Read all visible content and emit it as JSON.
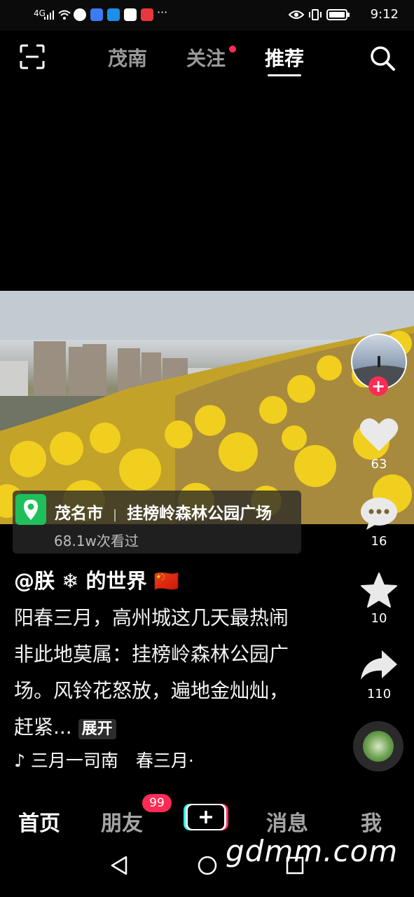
{
  "status_bar": {
    "signal": "4G",
    "time": "9:12"
  },
  "top_tabs": [
    {
      "label": "茂南"
    },
    {
      "label": "关注"
    },
    {
      "label": "推荐"
    }
  ],
  "video_stats": {
    "likes": "63",
    "comments": "16",
    "favorites": "10",
    "shares": "110"
  },
  "location": {
    "city": "茂名市",
    "place": "挂榜岭森林公园广场",
    "views": "68.1w次看过"
  },
  "post": {
    "author": "@朕 ❄ 的世界 🇨🇳",
    "caption": "阳春三月，高州城这几天最热闹非此地莫属：挂榜岭森林公园广场。风铃花怒放，遍地金灿灿，赶紧...",
    "expand_label": "展开"
  },
  "music": {
    "note": "♪",
    "title": "三月一司南　春三月·"
  },
  "bottom_nav": {
    "home": "首页",
    "friends": "朋友",
    "friends_badge": "99",
    "messages": "消息",
    "me": "我"
  },
  "watermark": "gdmm.com",
  "colors": {
    "accent": "#fe2c55",
    "location_green": "#1fbf5a"
  }
}
